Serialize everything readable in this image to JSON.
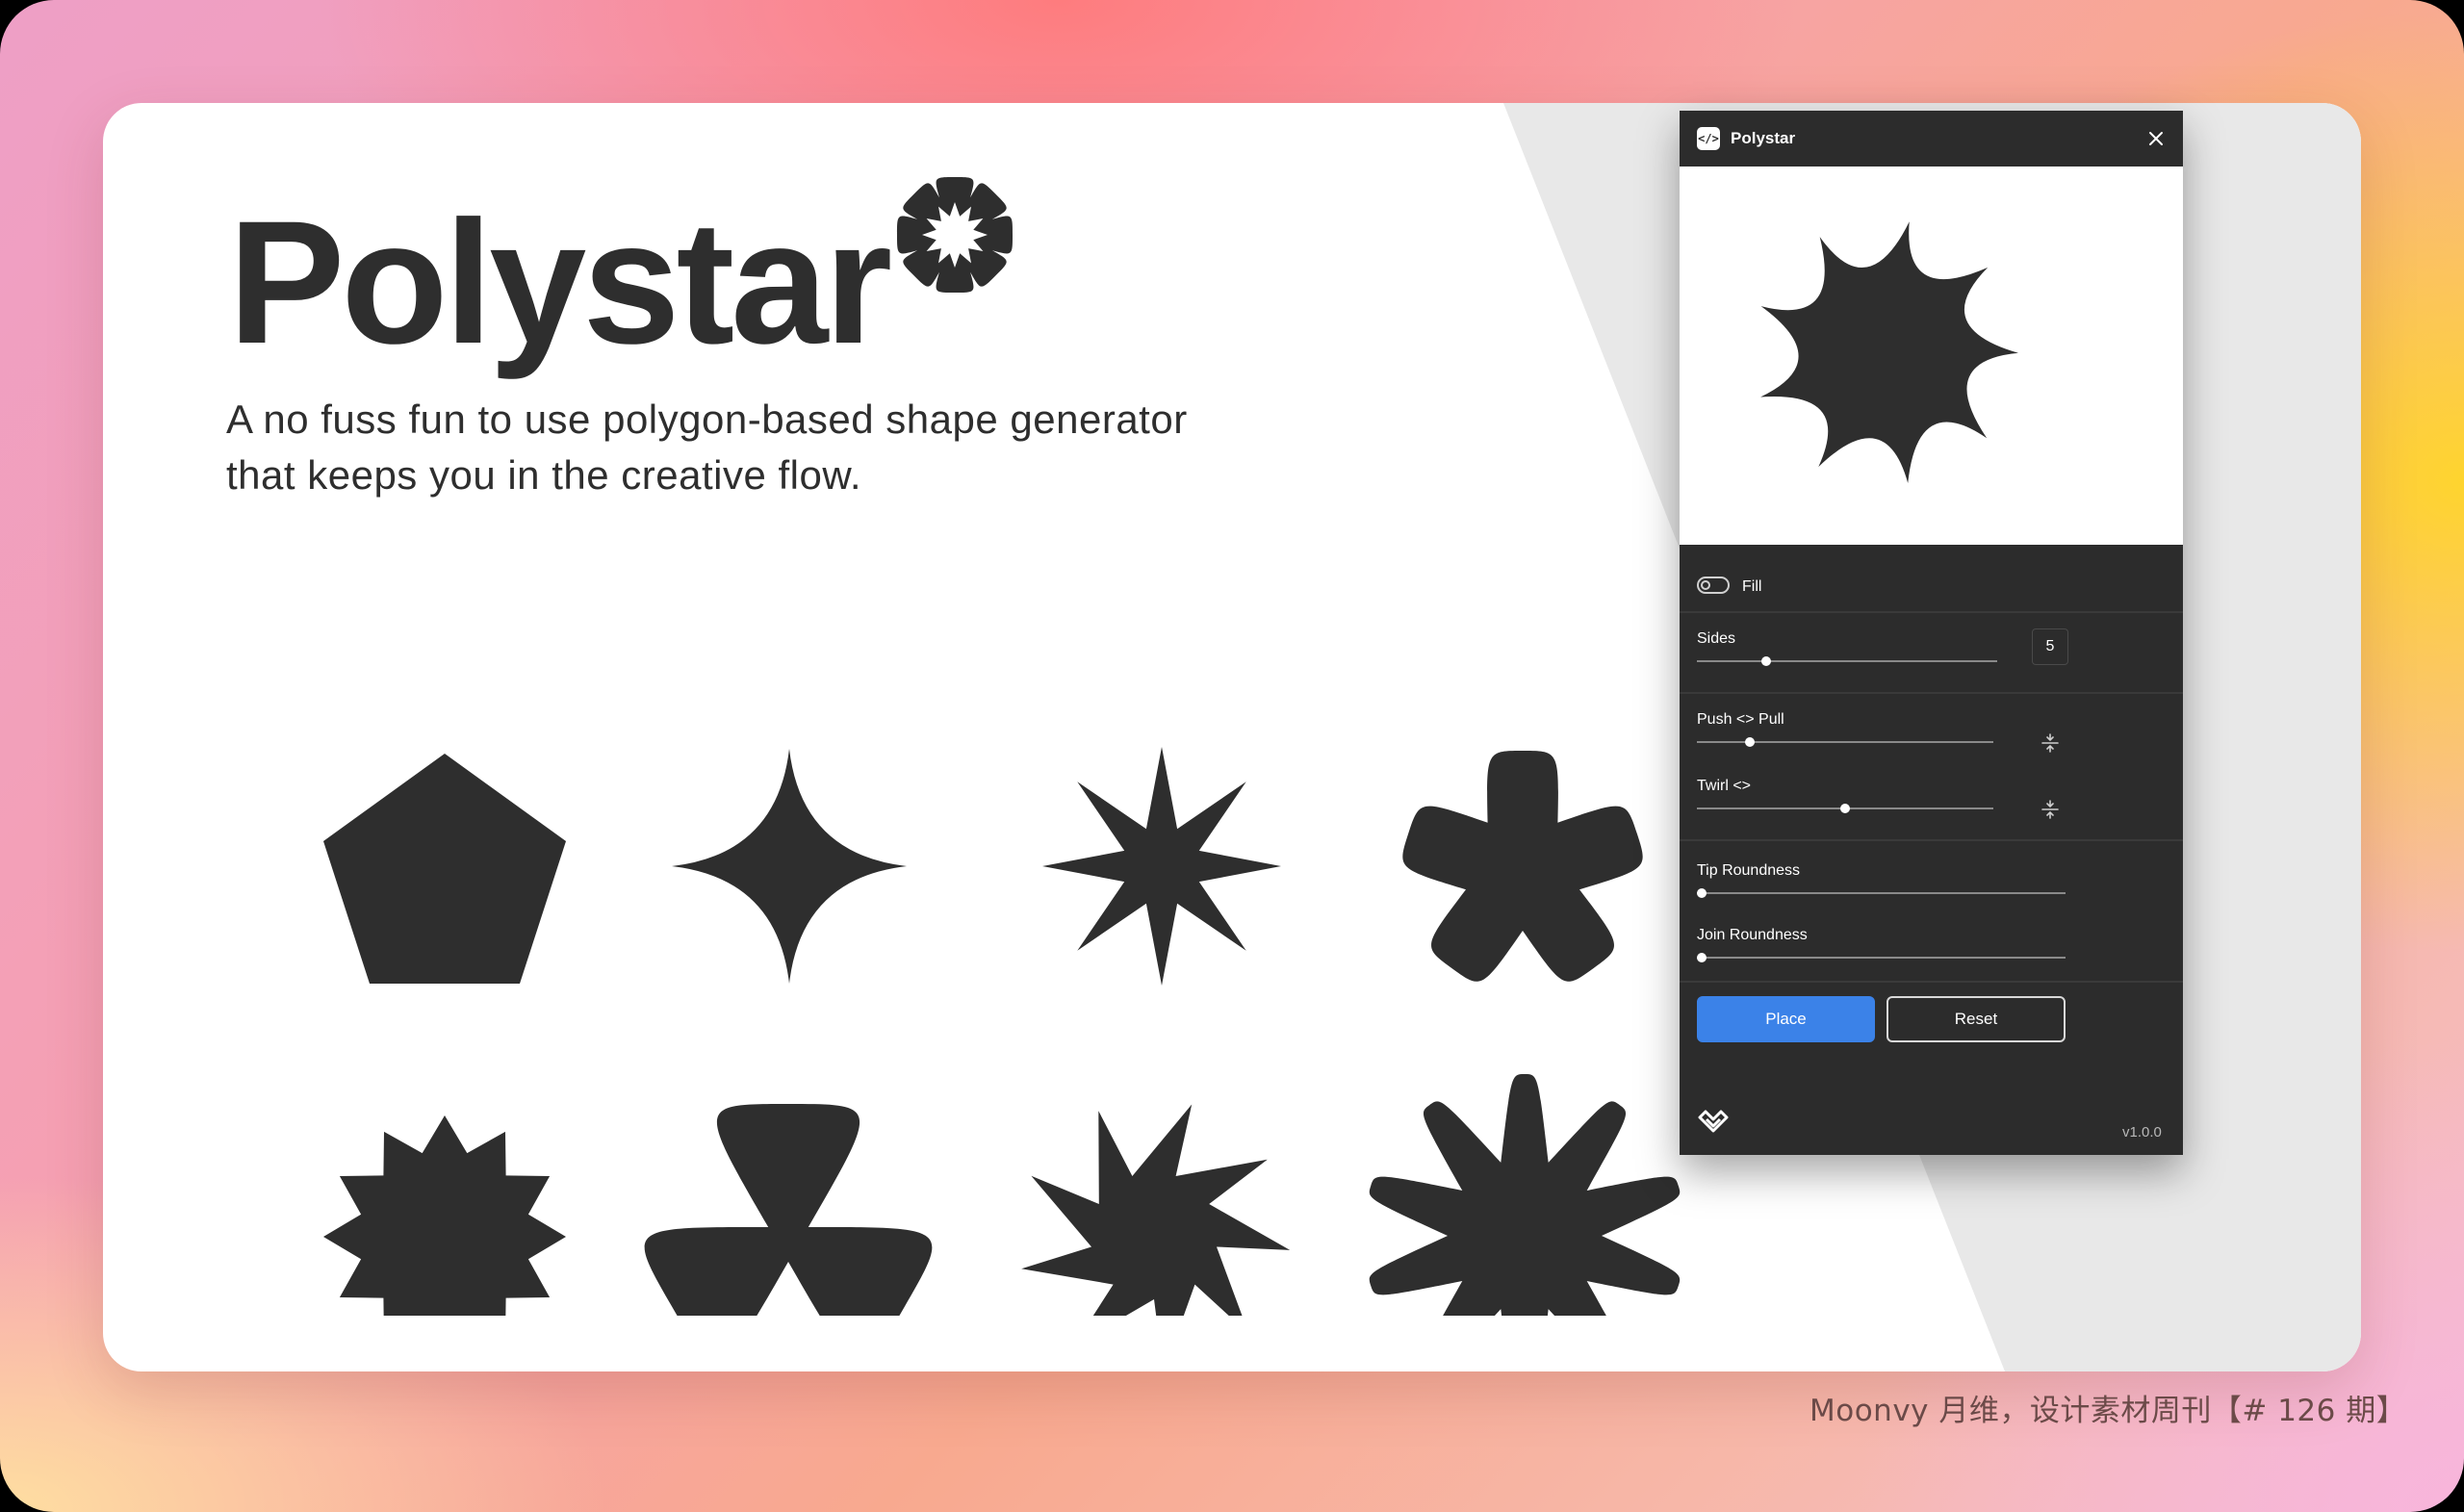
{
  "hero": {
    "title": "Polystar",
    "subtitle_line1": "A no fuss fun to use polygon-based shape generator",
    "subtitle_line2": "that keeps you in the creative flow.",
    "badge_icon": "polystar-badge-icon"
  },
  "gallery": {
    "shapes": [
      "pentagon-shape-icon",
      "four-point-sparkle-shape-icon",
      "eight-point-star-shape-icon",
      "rounded-five-point-star-shape-icon",
      "twelve-point-badge-shape-icon",
      "three-blade-propeller-shape-icon",
      "swirl-star-shape-icon",
      "ten-point-splat-shape-icon"
    ],
    "fill_color": "#2e2e2e"
  },
  "plugin": {
    "title": "Polystar",
    "fill_label": "Fill",
    "fill_enabled": false,
    "sides_label": "Sides",
    "sides_value": "5",
    "sides_slider_fraction": 0.23,
    "push_pull_label": "Push <> Pull",
    "push_pull_fraction": 0.18,
    "twirl_label": "Twirl <>",
    "twirl_fraction": 0.5,
    "tip_roundness_label": "Tip Roundness",
    "tip_roundness_fraction": 0.0,
    "join_roundness_label": "Join Roundness",
    "join_roundness_fraction": 0.0,
    "place_label": "Place",
    "reset_label": "Reset",
    "version": "v1.0.0",
    "accent_color": "#3b82e8",
    "panel_color": "#2c2c2c"
  },
  "credit": "Moonvy 月维，设计素材周刊【# 126 期】"
}
